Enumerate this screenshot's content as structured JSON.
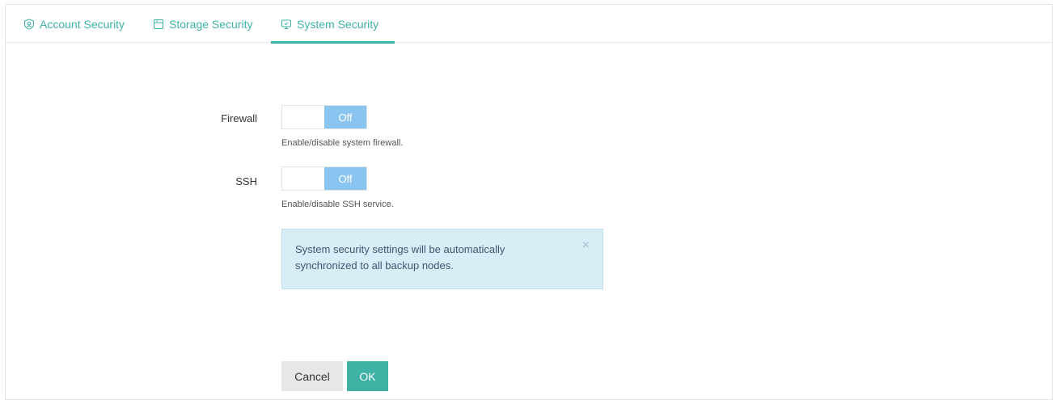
{
  "tabs": [
    {
      "label": "Account Security",
      "icon": "user-shield-icon",
      "active": false
    },
    {
      "label": "Storage Security",
      "icon": "storage-icon",
      "active": false
    },
    {
      "label": "System Security",
      "icon": "monitor-icon",
      "active": true
    }
  ],
  "settings": {
    "firewall": {
      "label": "Firewall",
      "state": "Off",
      "hint": "Enable/disable system firewall."
    },
    "ssh": {
      "label": "SSH",
      "state": "Off",
      "hint": "Enable/disable SSH service."
    }
  },
  "alert": {
    "message": "System security settings will be automatically synchronized to all backup nodes.",
    "close": "×"
  },
  "buttons": {
    "cancel": "Cancel",
    "ok": "OK"
  },
  "colors": {
    "accent": "#3fb1a5",
    "toggle_off": "#8ac4f0",
    "alert_bg": "#d9edf7"
  }
}
